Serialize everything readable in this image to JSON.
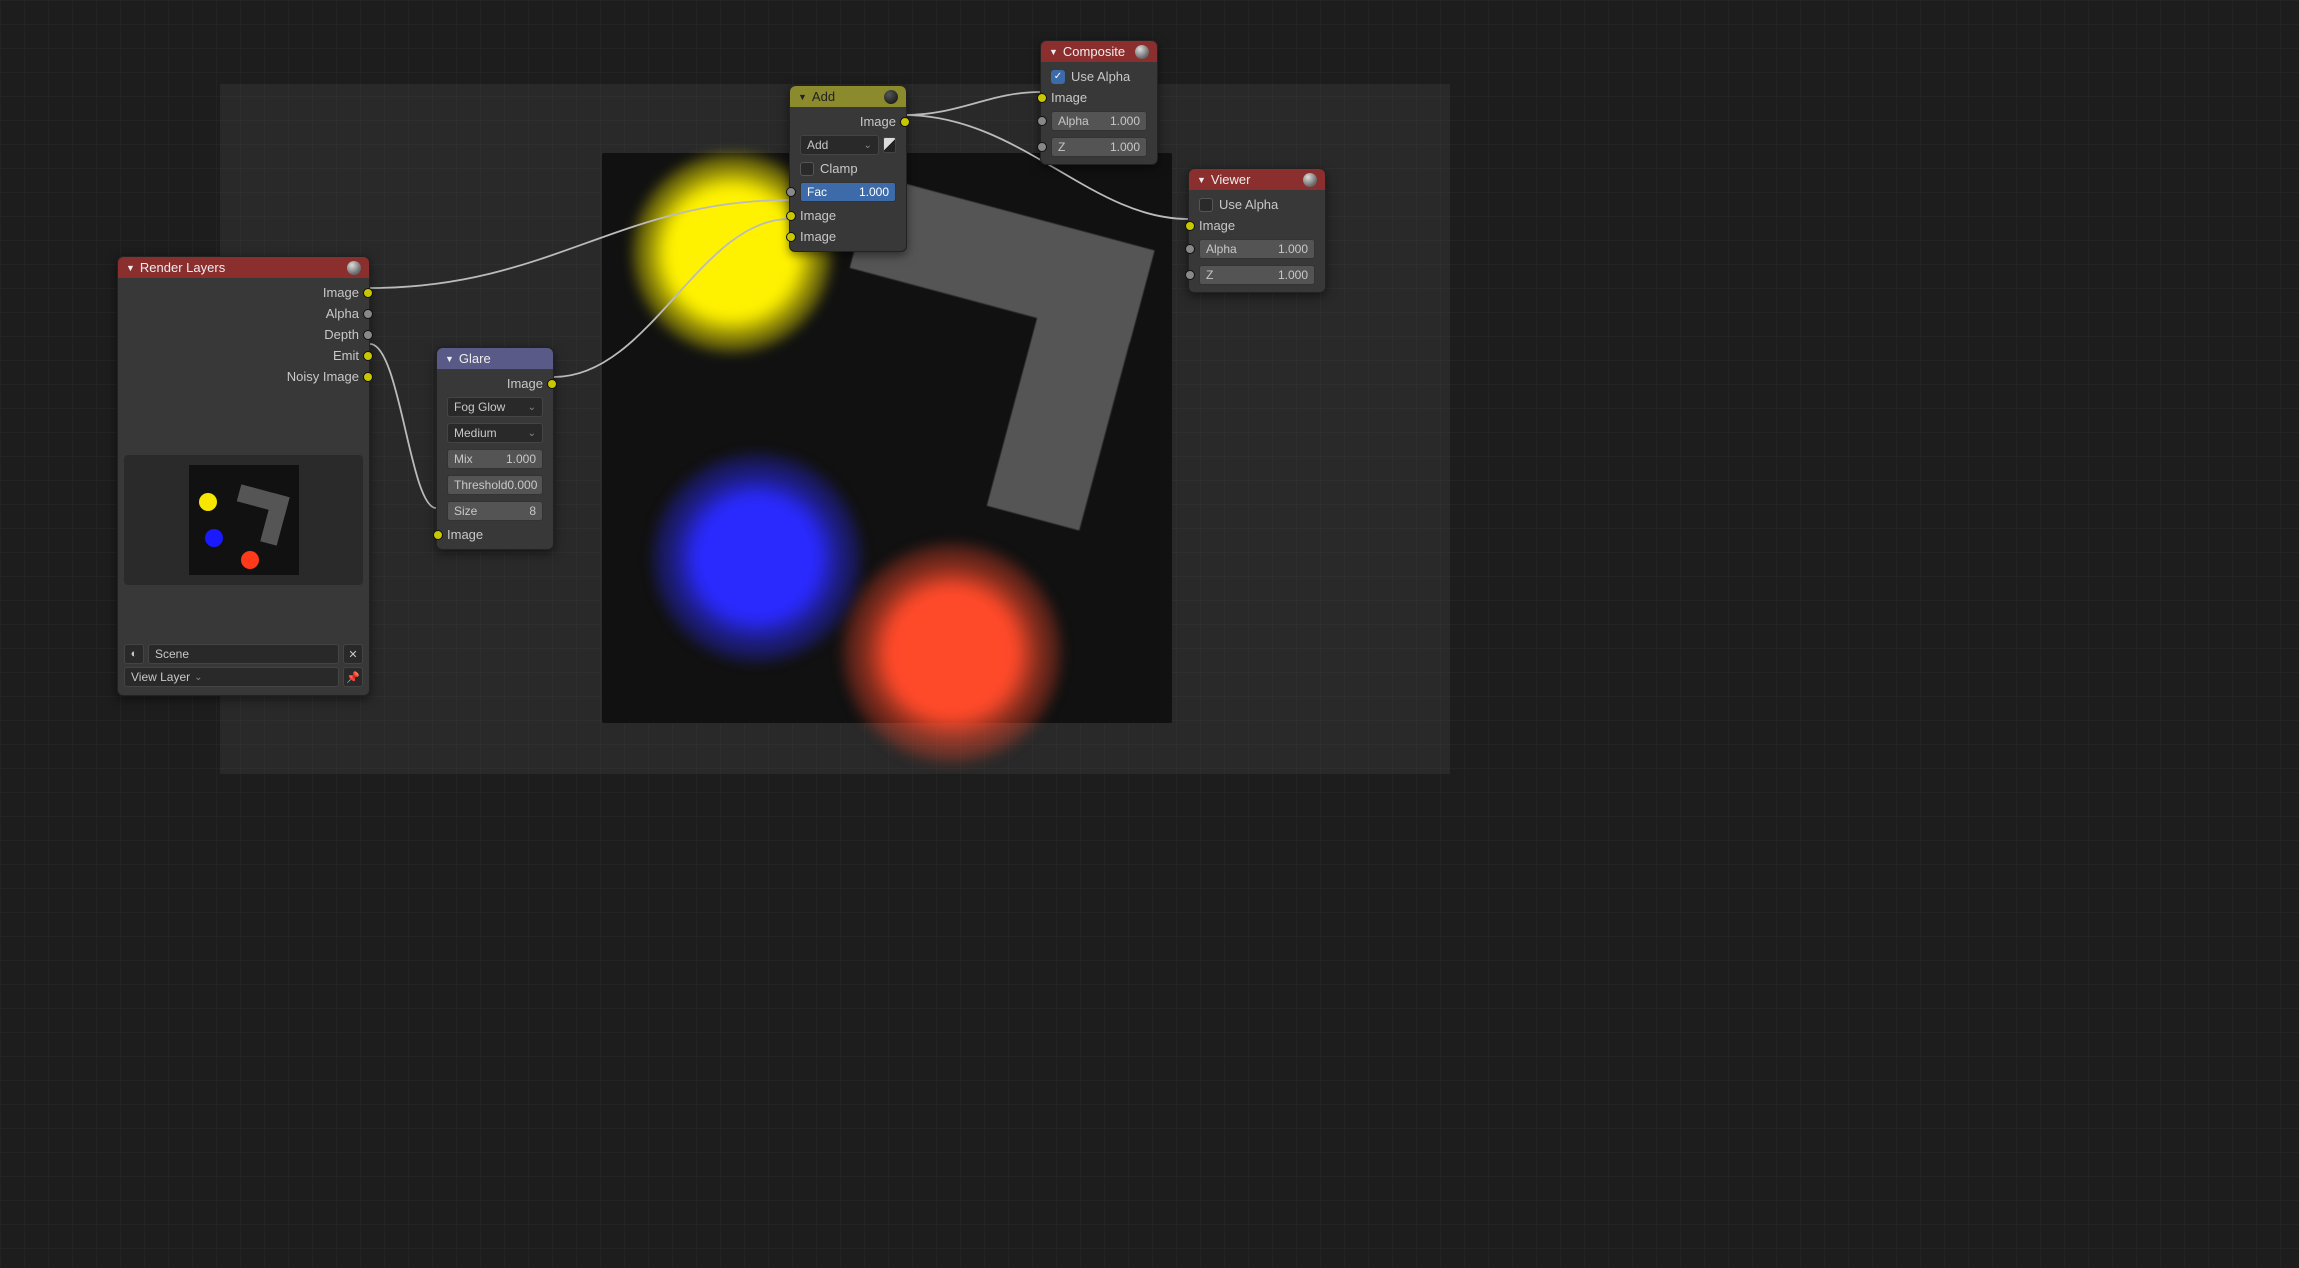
{
  "nodes": {
    "render_layers": {
      "title": "Render Layers",
      "outputs": [
        "Image",
        "Alpha",
        "Depth",
        "Emit",
        "Noisy Image"
      ],
      "scene_label": "Scene",
      "view_layer_label": "View Layer"
    },
    "glare": {
      "title": "Glare",
      "output": "Image",
      "type_select": "Fog Glow",
      "quality_select": "Medium",
      "mix": {
        "label": "Mix",
        "value": "1.000"
      },
      "threshold": {
        "label": "Threshold",
        "value": "0.000"
      },
      "size": {
        "label": "Size",
        "value": "8"
      },
      "input": "Image"
    },
    "add": {
      "title": "Add",
      "output": "Image",
      "mode_select": "Add",
      "clamp_label": "Clamp",
      "fac": {
        "label": "Fac",
        "value": "1.000"
      },
      "input1": "Image",
      "input2": "Image"
    },
    "composite": {
      "title": "Composite",
      "use_alpha": "Use Alpha",
      "image_in": "Image",
      "alpha": {
        "label": "Alpha",
        "value": "1.000"
      },
      "z": {
        "label": "Z",
        "value": "1.000"
      }
    },
    "viewer": {
      "title": "Viewer",
      "use_alpha": "Use Alpha",
      "image_in": "Image",
      "alpha": {
        "label": "Alpha",
        "value": "1.000"
      },
      "z": {
        "label": "Z",
        "value": "1.000"
      }
    }
  }
}
